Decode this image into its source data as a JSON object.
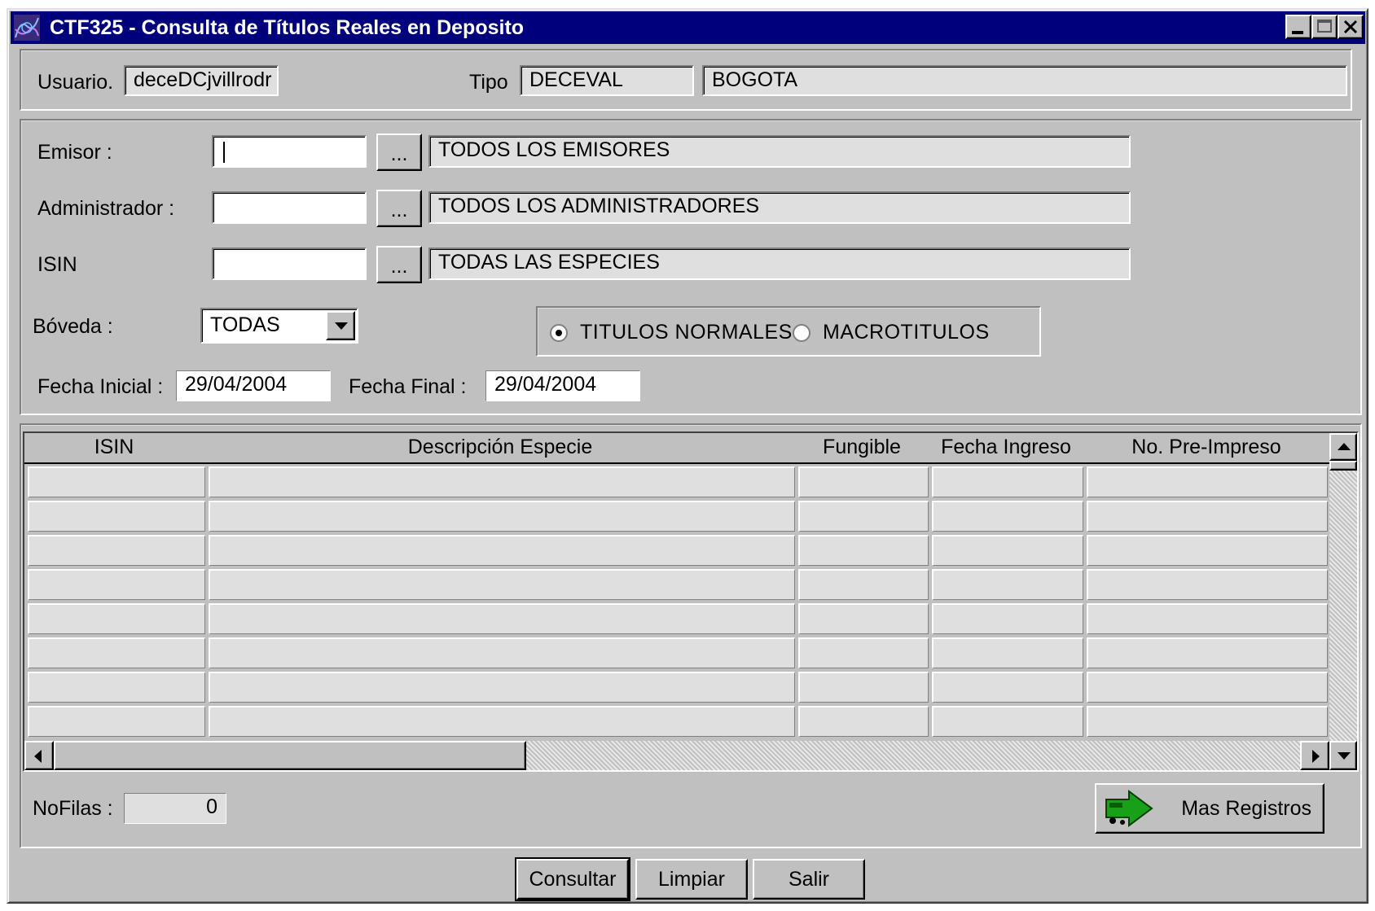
{
  "window": {
    "title": "CTF325 - Consulta de Títulos Reales en Deposito"
  },
  "header": {
    "usuario_label": "Usuario.",
    "usuario_value": "deceDCjvillrodr",
    "tipo_label": "Tipo",
    "tipo_value": "DECEVAL",
    "ciudad_value": "BOGOTA"
  },
  "filters": {
    "emisor_label": "Emisor :",
    "emisor_value": "",
    "emisor_desc": "TODOS LOS EMISORES",
    "administrador_label": "Administrador :",
    "administrador_value": "",
    "administrador_desc": "TODOS LOS ADMINISTRADORES",
    "isin_label": "ISIN",
    "isin_value": "",
    "isin_desc": "TODAS LAS ESPECIES",
    "browse_label": "...",
    "boveda_label": "Bóveda :",
    "boveda_selected": "TODAS",
    "radio_normales": "TITULOS NORMALES",
    "radio_macro": "MACROTITULOS",
    "selected_radio": "TITULOS NORMALES",
    "fecha_inicial_label": "Fecha Inicial :",
    "fecha_inicial_value": "29/04/2004",
    "fecha_final_label": "Fecha Final :",
    "fecha_final_value": "29/04/2004"
  },
  "grid": {
    "columns": [
      "ISIN",
      "Descripción Especie",
      "Fungible",
      "Fecha Ingreso",
      "No. Pre-Impreso"
    ],
    "rows": [
      [
        "",
        "",
        "",
        "",
        ""
      ],
      [
        "",
        "",
        "",
        "",
        ""
      ],
      [
        "",
        "",
        "",
        "",
        ""
      ],
      [
        "",
        "",
        "",
        "",
        ""
      ],
      [
        "",
        "",
        "",
        "",
        ""
      ],
      [
        "",
        "",
        "",
        "",
        ""
      ],
      [
        "",
        "",
        "",
        "",
        ""
      ],
      [
        "",
        "",
        "",
        "",
        ""
      ]
    ]
  },
  "footer": {
    "nofilas_label": "NoFilas :",
    "nofilas_value": "0",
    "mas_registros_label": "Mas Registros"
  },
  "actions": {
    "consultar_label": "Consultar",
    "limpiar_label": "Limpiar",
    "salir_label": "Salir"
  },
  "colors": {
    "titlebar": "#00007c",
    "face": "#c0c0c0",
    "readonly_field": "#dfdfdf"
  }
}
